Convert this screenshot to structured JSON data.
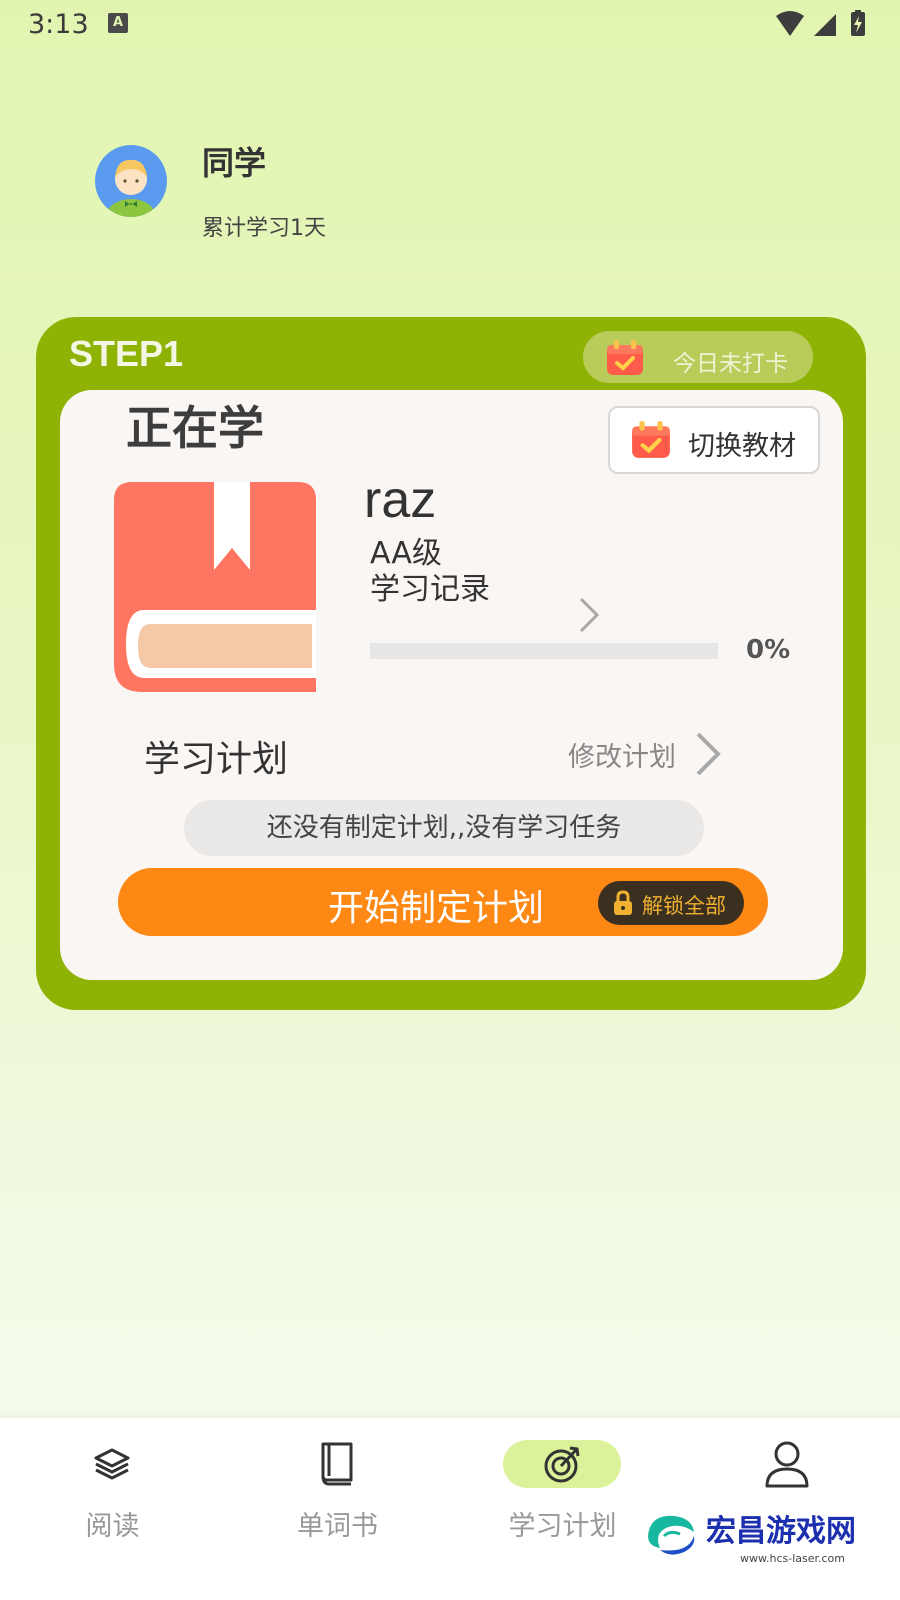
{
  "status_bar": {
    "time": "3:13",
    "notification_badge": "A"
  },
  "user": {
    "name": "同学",
    "study_days": "累计学习1天"
  },
  "card": {
    "step": "STEP1",
    "checkin_status": "今日未打卡",
    "learning_title": "正在学",
    "switch_button": "切换教材",
    "book": {
      "name": "raz",
      "level": "AA级",
      "record_link": "学习记录",
      "progress_percent": 0,
      "progress_text": "0%"
    },
    "plan": {
      "title": "学习计划",
      "modify": "修改计划",
      "empty_message": "还没有制定计划,,没有学习任务",
      "start_button": "开始制定计划",
      "unlock": "解锁全部"
    }
  },
  "tabs": [
    {
      "label": "阅读",
      "icon": "layers-icon",
      "active": false
    },
    {
      "label": "单词书",
      "icon": "book-icon",
      "active": false
    },
    {
      "label": "学习计划",
      "icon": "target-icon",
      "active": true
    },
    {
      "label": "",
      "icon": "user-icon",
      "active": false
    }
  ],
  "watermark": {
    "title": "宏昌游戏网",
    "url": "www.hcs-laser.com"
  },
  "colors": {
    "card_green": "#8fb304",
    "accent_orange": "#fe8814",
    "book_red": "#fe7561",
    "active_tab_bg": "#dcf29a"
  }
}
